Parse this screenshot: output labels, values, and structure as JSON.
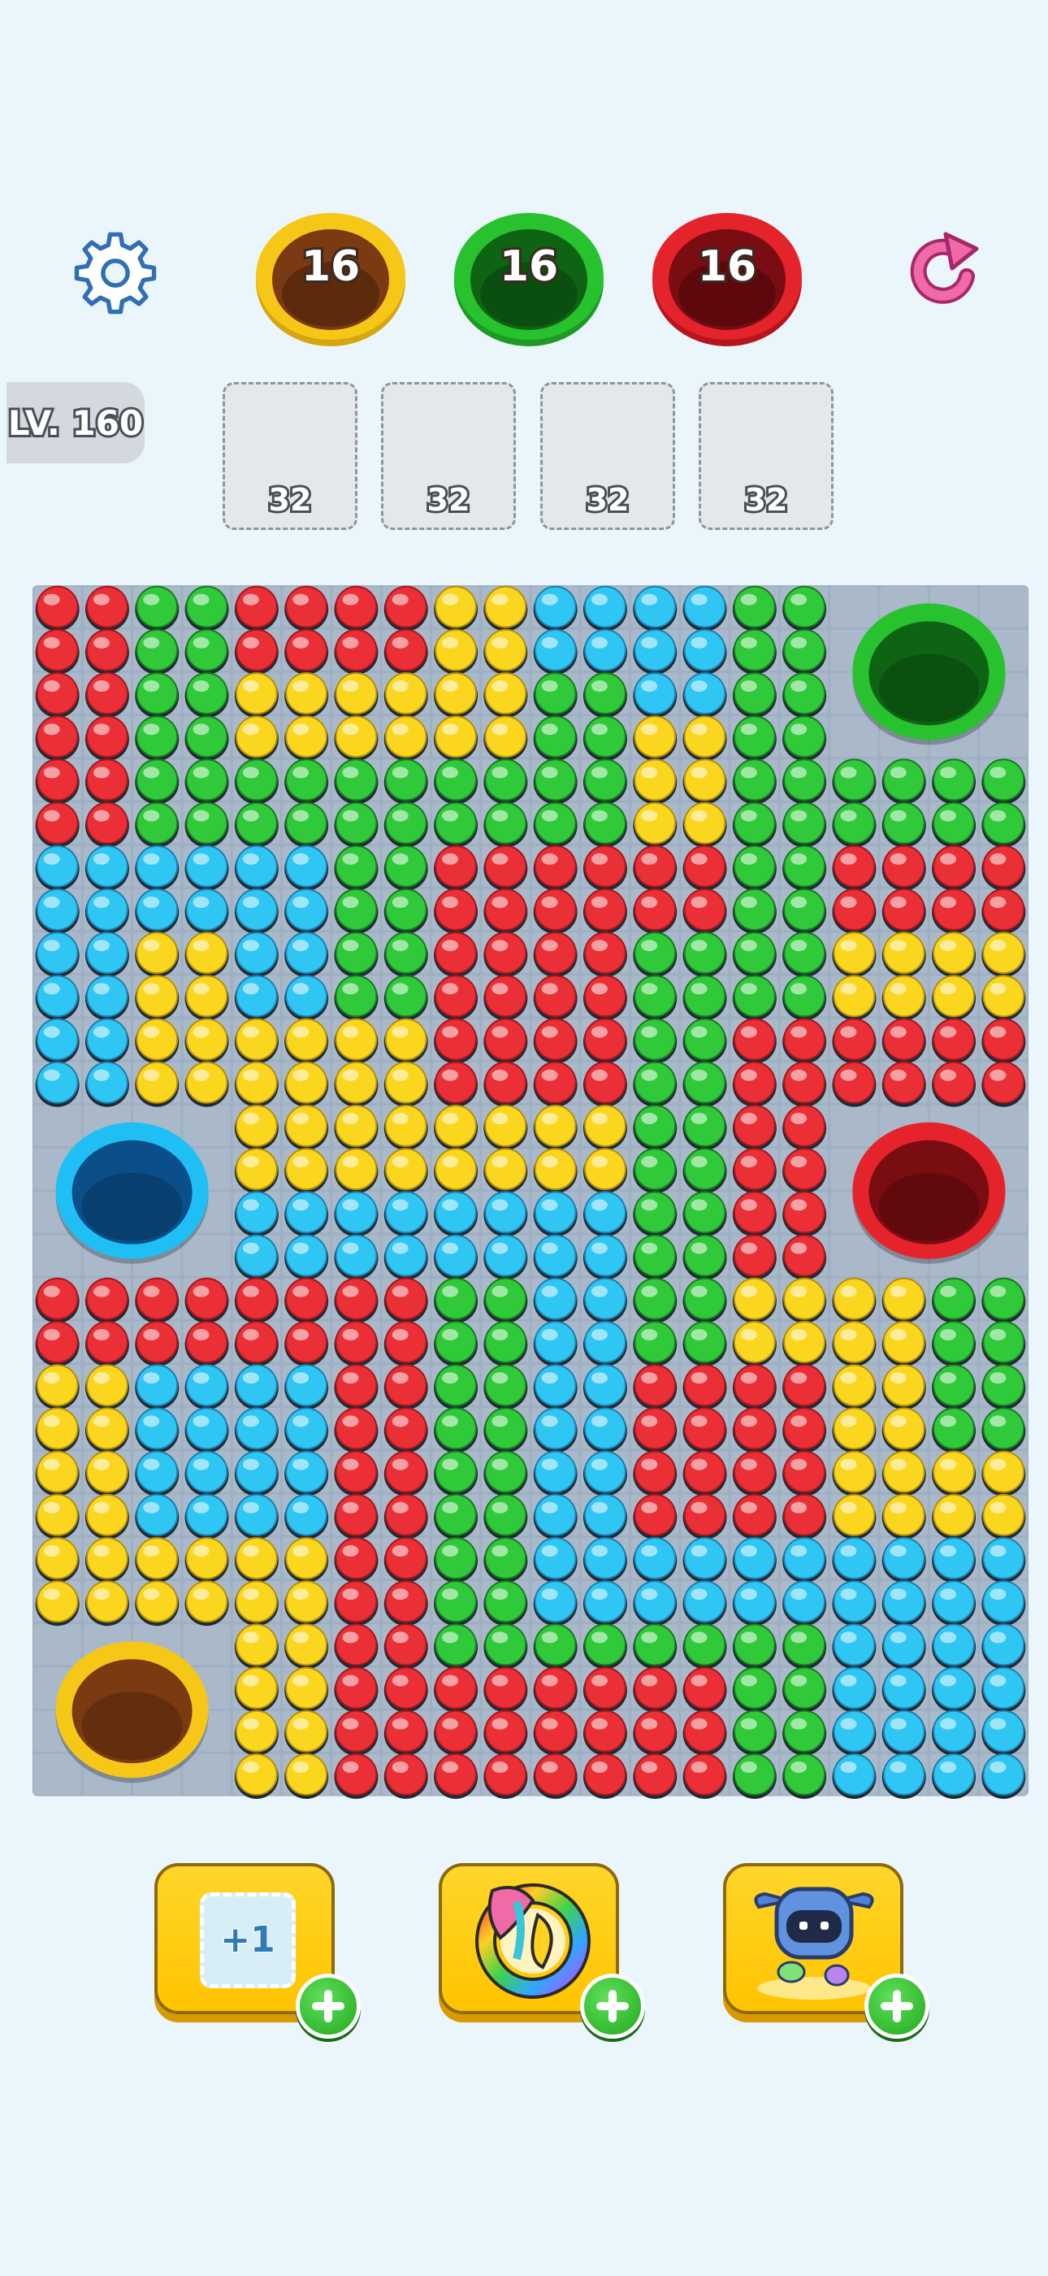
{
  "top_bar": {
    "settings_icon": "gear-icon",
    "undo_icon": "refresh-arrow-icon",
    "hole_counters": [
      {
        "color": "#f7c718",
        "inner": "#7b3a12",
        "value": "16"
      },
      {
        "color": "#27c22e",
        "inner": "#0f6414",
        "value": "16"
      },
      {
        "color": "#e4242a",
        "inner": "#7a0d12",
        "value": "16"
      }
    ]
  },
  "level": {
    "label": "LV. 160"
  },
  "slots": [
    {
      "capacity": "32"
    },
    {
      "capacity": "32"
    },
    {
      "capacity": "32"
    },
    {
      "capacity": "32"
    }
  ],
  "board": {
    "palette": {
      "R": "#ea2f36",
      "G": "#2fc93a",
      "B": "#2fc6f4",
      "Y": "#fbd61e"
    },
    "tile_color": "#9fb0c2",
    "rows": [
      "RRGGRRRRYYBBBBGG....",
      "RRGGRRRRYYBBBBGG....",
      "RRGGYYYYYYGGBBGG....",
      "RRGGYYYYYYGGYYGG....",
      "RRGGGGGGGGGGYYGGGGGG",
      "RRGGGGGGGGGGYYGGGGGG",
      "BBBBBBGGRRRRRRGGRRRR",
      "BBBBBBGGRRRRRRGGRRRR",
      "BBYYBBGGRRRRGGGGYYYY",
      "BBYYBBGGRRRRGGGGYYYY",
      "BBYYYYYYRRRRGGRRRRRR",
      "BBYYYYYYRRRRGGRRRRRR",
      "....YYYYYYYYGGRR....",
      "....YYYYYYYYGGRR....",
      "....BBBBBBBBGGRR....",
      "....BBBBBBBBGGRR....",
      "RRRRRRRRGGBBGGYYYYGG",
      "RRRRRRRRGGBBGGYYYYGG",
      "YYBBBBRRGGBBRRRRYYGG",
      "YYBBBBRRGGBBRRRRYYGG",
      "YYBBBBRRGGBBRRRRYYYY",
      "YYBBBBRRGGBBRRRRYYYY",
      "YYYYYYRRGGBBBBBBBBBB",
      "YYYYYYRRGGBBBBBBBBBB",
      "....YYRRGGGGGGGGBBBB",
      "....YYRRRRRRRRGGBBBB",
      "....YYRRRRRRRRGGBBBB",
      "....YYRRRRRRRRGGBBBB"
    ],
    "holes": [
      {
        "name": "green-hole",
        "color": "#27c22e",
        "inner": "#0f6414"
      },
      {
        "name": "blue-hole",
        "color": "#1fbff5",
        "inner": "#0a4f8a"
      },
      {
        "name": "red-hole",
        "color": "#e4242a",
        "inner": "#7a0d12"
      },
      {
        "name": "yellow-hole",
        "color": "#f7c718",
        "inner": "#7b3a12"
      }
    ]
  },
  "boosters": [
    {
      "name": "add-slot-booster",
      "label": "+1",
      "icon": "plus-one-slot-icon"
    },
    {
      "name": "rainbow-booster",
      "icon": "rainbow-ring-icon"
    },
    {
      "name": "robot-booster",
      "icon": "robot-icon"
    }
  ]
}
